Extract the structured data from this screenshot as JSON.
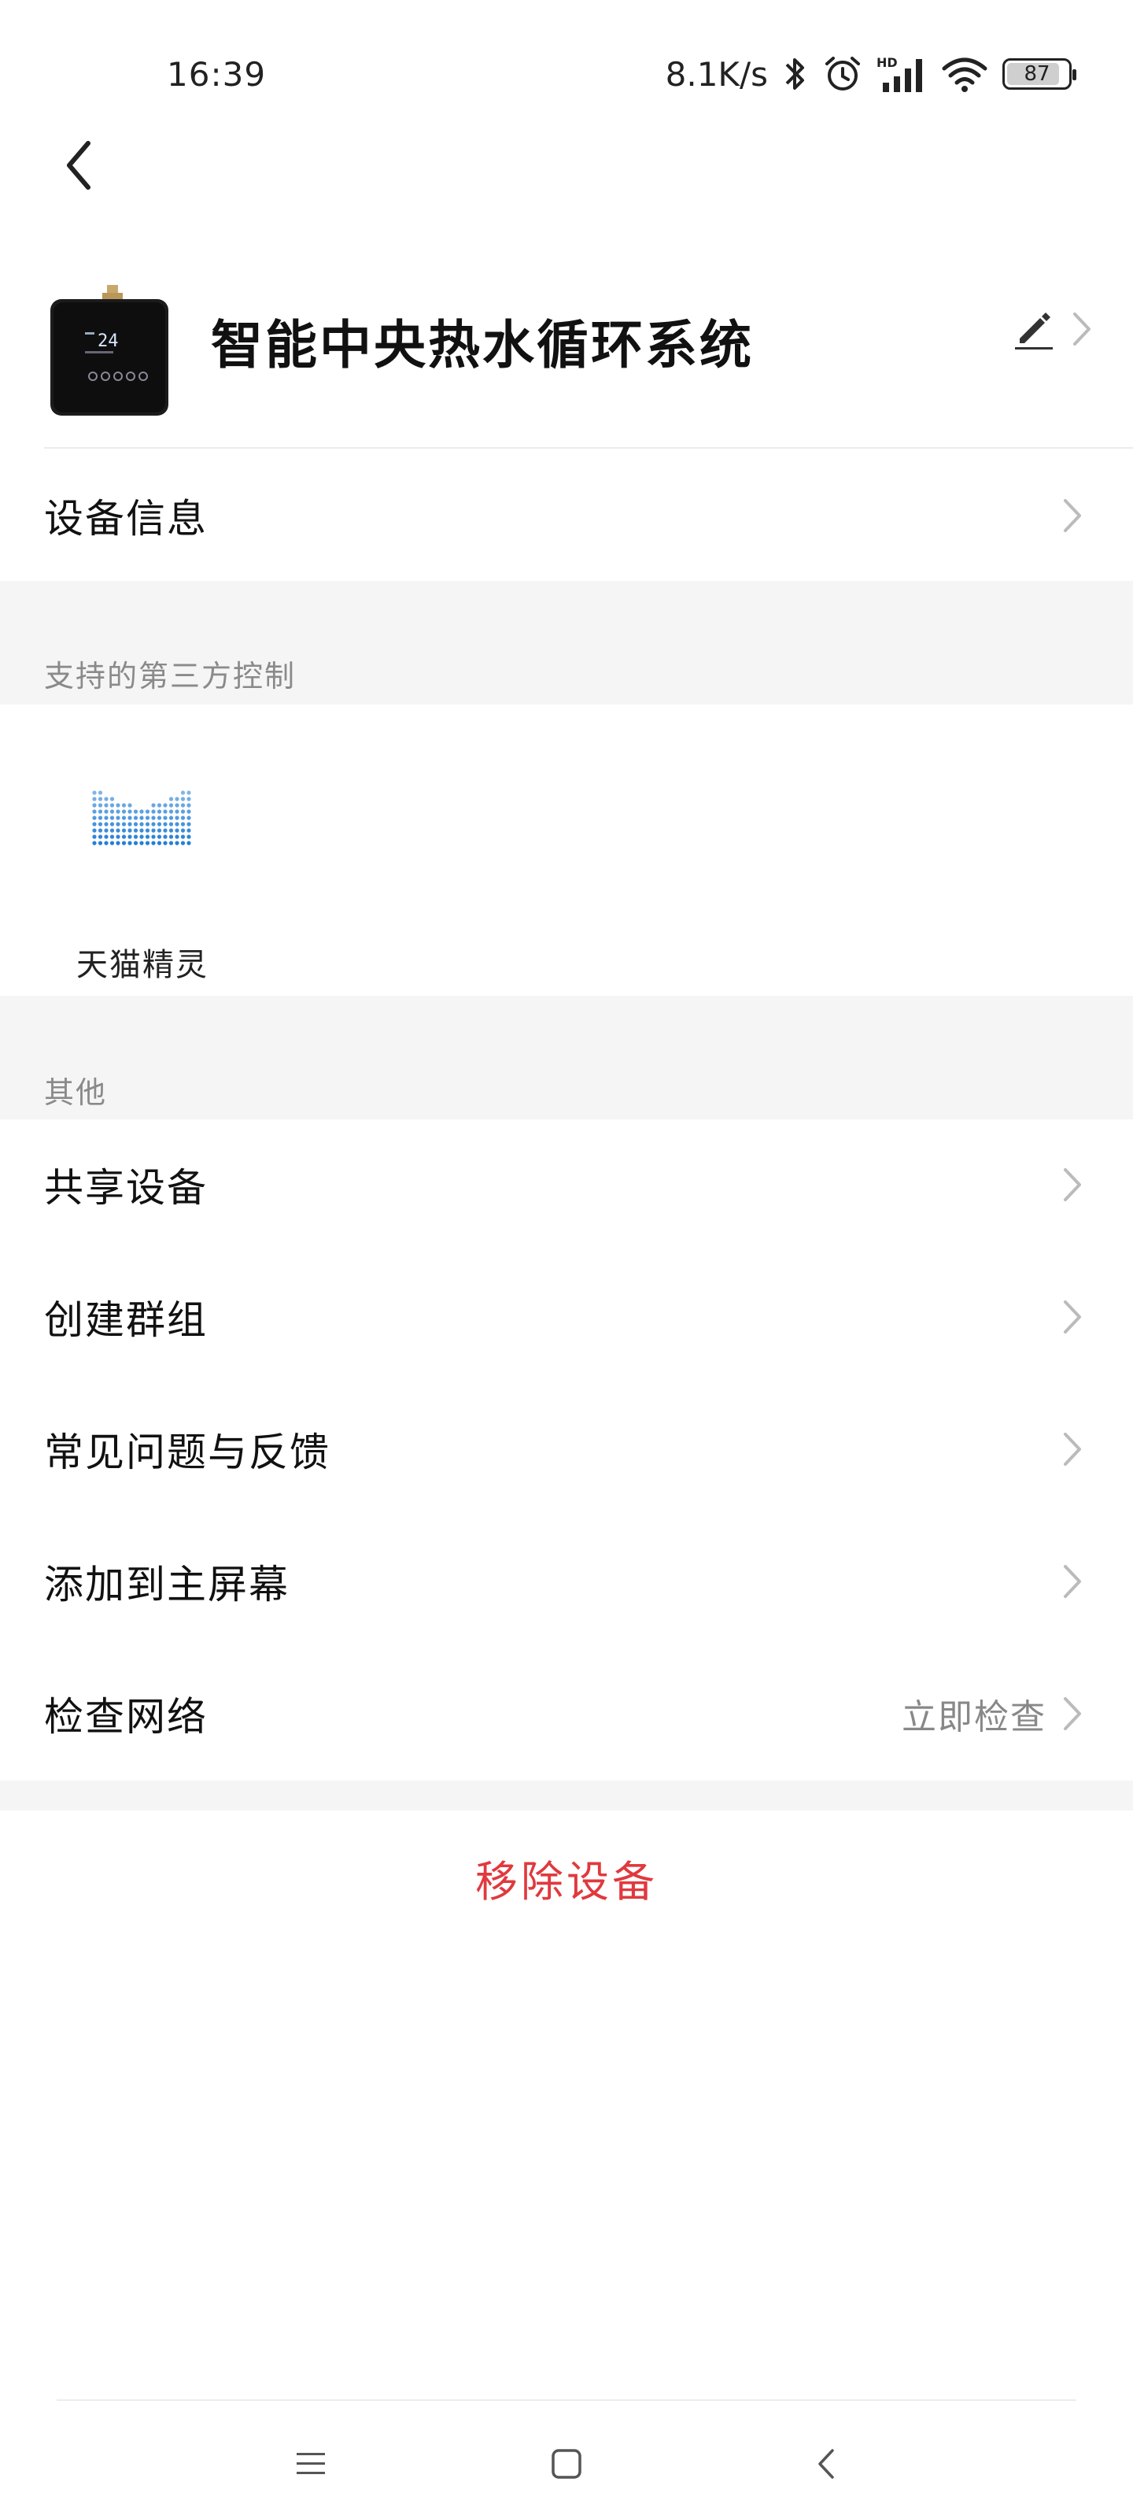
{
  "status_bar": {
    "time": "16:39",
    "network_speed": "8.1K/s",
    "battery_level": "87",
    "battery_fraction": 0.87,
    "icons": [
      "bluetooth-icon",
      "alarm-icon",
      "hd-signal-icon",
      "wifi-icon",
      "battery-icon"
    ]
  },
  "header": {
    "device_name": "智能中央热水循环系统"
  },
  "rows": {
    "device_info": "设备信息"
  },
  "third_party": {
    "section_title": "支持的第三方控制",
    "items": [
      {
        "label": "天猫精灵",
        "icon": "tmall-genie-logo"
      }
    ]
  },
  "other": {
    "section_title": "其他",
    "items": [
      {
        "label": "共享设备"
      },
      {
        "label": "创建群组"
      },
      {
        "label": "常见问题与反馈"
      },
      {
        "label": "添加到主屏幕"
      },
      {
        "label": "检查网络",
        "extra": "立即检查"
      }
    ]
  },
  "actions": {
    "remove_device": "移除设备"
  },
  "colors": {
    "accent_red": "#e0393e",
    "section_bg": "#f5f5f5",
    "tmall_blue": "#1a78d2"
  }
}
